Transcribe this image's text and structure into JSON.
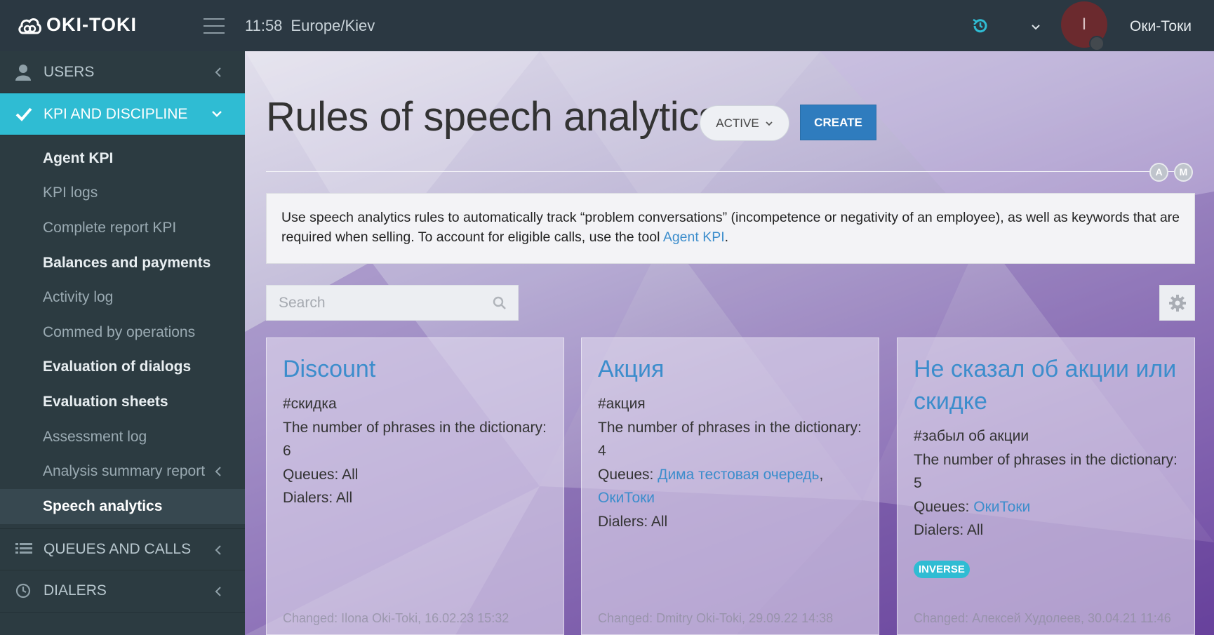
{
  "header": {
    "logo_text": "OKI-TOKI",
    "time": "11:58",
    "timezone": "Europe/Kiev",
    "avatar_letter": "I",
    "user_name": "Оки-Токи"
  },
  "sidebar": {
    "users_label": "USERS",
    "kpi_label": "KPI AND DISCIPLINE",
    "items": [
      {
        "label": "Agent KPI"
      },
      {
        "label": "KPI logs"
      },
      {
        "label": "Complete report KPI"
      },
      {
        "label": "Balances and payments"
      },
      {
        "label": "Activity log"
      },
      {
        "label": "Commed by operations"
      },
      {
        "label": "Evaluation of dialogs"
      },
      {
        "label": "Evaluation sheets"
      },
      {
        "label": "Assessment log"
      },
      {
        "label": "Analysis summary report"
      },
      {
        "label": "Speech analytics"
      }
    ],
    "queues_label": "QUEUES AND CALLS",
    "dialers_label": "DIALERS"
  },
  "main": {
    "title": "Rules of speech analytics",
    "status_label": "ACTIVE",
    "create_label": "CREATE",
    "badge_a": "A",
    "badge_m": "M",
    "info_text_1": "Use speech analytics rules to automatically track “problem conversations” (incompetence or negativity of an employee), as well as keywords that are required when selling. To account for eligible calls, use the tool ",
    "info_link": "Agent KPI",
    "info_text_2": ".",
    "search_placeholder": "Search",
    "cards": [
      {
        "title": "Discount",
        "tag": "#скидка",
        "phrases": "The number of phrases in the dictionary: 6",
        "queues_label": "Queues: ",
        "queues_value": "All",
        "dialers": "Dialers: All",
        "changed": "Changed: Ilona Oki-Toki, 16.02.23 15:32"
      },
      {
        "title": "Акция",
        "tag": "#акция",
        "phrases": "The number of phrases in the dictionary: 4",
        "queues_label": "Queues: ",
        "queue_link_1": "Дима тестовая очередь",
        "queue_sep": ",",
        "queue_link_2": "ОкиТоки",
        "dialers": "Dialers: All",
        "changed": "Changed: Dmitry Oki-Toki, 29.09.22 14:38"
      },
      {
        "title": "Не сказал об акции или скидке",
        "tag": "#забыл об акции",
        "phrases": "The number of phrases in the dictionary: 5",
        "queues_label": "Queues: ",
        "queue_link_1": "ОкиТоки",
        "dialers": "Dialers: All",
        "badge": "INVERSE",
        "changed": "Changed: Алексей Худолеев, 30.04.21 11:46"
      }
    ]
  }
}
